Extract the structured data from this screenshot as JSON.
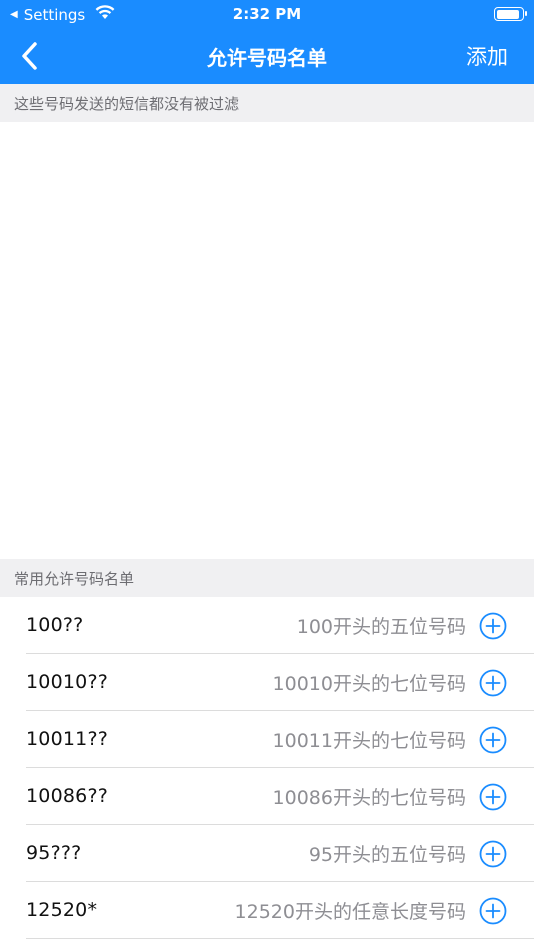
{
  "status_bar": {
    "back_app": "Settings",
    "time": "2:32 PM"
  },
  "nav": {
    "title": "允许号码名单",
    "add_label": "添加"
  },
  "top_section": {
    "description": "这些号码发送的短信都没有被过滤"
  },
  "common_section": {
    "title": "常用允许号码名单",
    "items": [
      {
        "number": "100??",
        "description": "100开头的五位号码"
      },
      {
        "number": "10010??",
        "description": "10010开头的七位号码"
      },
      {
        "number": "10011??",
        "description": "10011开头的七位号码"
      },
      {
        "number": "10086??",
        "description": "10086开头的七位号码"
      },
      {
        "number": "95???",
        "description": "95开头的五位号码"
      },
      {
        "number": "12520*",
        "description": "12520开头的任意长度号码"
      }
    ]
  },
  "colors": {
    "accent": "#1a8cff",
    "section_bg": "#f0f0f2",
    "secondary_text": "#8e8e93"
  }
}
